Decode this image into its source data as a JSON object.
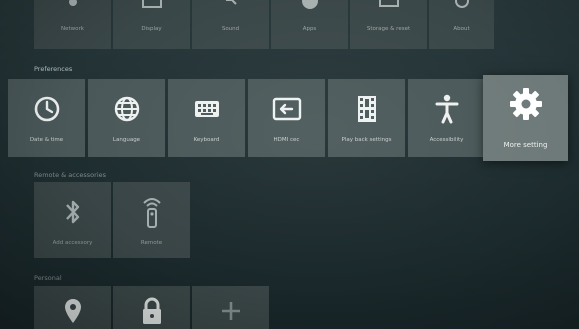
{
  "top_row": [
    "Network",
    "Display",
    "Sound",
    "Apps",
    "Storage & reset",
    "About"
  ],
  "sections": {
    "preferences": "Preferences",
    "remote": "Remote & accessories",
    "personal": "Personal"
  },
  "preferences_items": [
    {
      "label": "Date & time",
      "icon": "clock-icon"
    },
    {
      "label": "Language",
      "icon": "globe-icon"
    },
    {
      "label": "Keyboard",
      "icon": "keyboard-icon"
    },
    {
      "label": "HDMI cec",
      "icon": "hdmi-input-icon"
    },
    {
      "label": "Play back settings",
      "icon": "film-icon"
    },
    {
      "label": "Accessibility",
      "icon": "accessibility-icon"
    },
    {
      "label": "More setting",
      "icon": "gear-icon"
    }
  ],
  "remote_items": [
    {
      "label": "Add accessory",
      "icon": "bluetooth-icon"
    },
    {
      "label": "Remote",
      "icon": "remote-icon"
    }
  ],
  "personal_items": [
    {
      "label": "",
      "icon": "location-icon"
    },
    {
      "label": "",
      "icon": "lock-icon"
    },
    {
      "label": "",
      "icon": "add-icon"
    }
  ],
  "colors": {
    "background": "#1f2e31",
    "tile": "#4a5859",
    "tile_focused": "#6e7a79",
    "text": "#d8dddc"
  }
}
